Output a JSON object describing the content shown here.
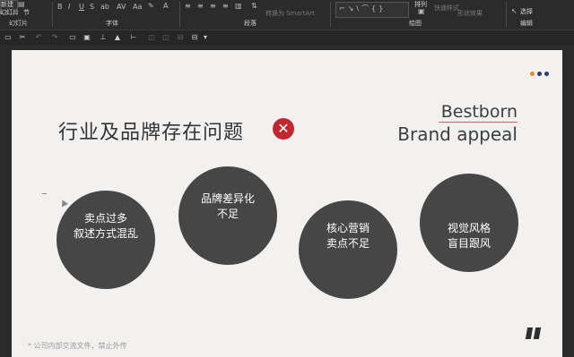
{
  "ribbon": {
    "new_slide_line1": "新建",
    "new_slide_line2": "幻灯片",
    "section_label": "节",
    "groups": [
      "幻灯片",
      "字体",
      "段落",
      "绘图",
      "编辑"
    ],
    "smartart_label": "转换为 SmartArt",
    "arrange_label": "排列",
    "quick_styles_label": "快速样式",
    "shape_effects_label": "形状效果",
    "select_label": "选择"
  },
  "slide": {
    "title": "行业及品牌存在问题",
    "brand_line1": "Bestborn",
    "brand_line2": "Brand appeal",
    "bubbles": [
      {
        "line1": "卖点过多",
        "line2": "叙述方式混乱"
      },
      {
        "line1": "品牌差异化",
        "line2": "不足"
      },
      {
        "line1": "核心营销",
        "line2": "卖点不足"
      },
      {
        "line1": "视觉风格",
        "line2": "盲目跟风"
      }
    ],
    "footer": "* 公司内部交流文件，禁止外传"
  },
  "colors": {
    "ribbon_bg": "#2b2b2b",
    "slide_bg": "#f2f1f0",
    "bubble": "#464646",
    "error_red": "#c0282e",
    "dot_orange": "#e08a2a",
    "dot_navy": "#2d3a6e"
  },
  "icons": [
    "new-slide-icon",
    "bold-icon",
    "italic-icon",
    "underline-icon",
    "align-icon",
    "shapes-icon",
    "arrange-icon",
    "select-icon",
    "close-x-icon",
    "quote-icon"
  ]
}
